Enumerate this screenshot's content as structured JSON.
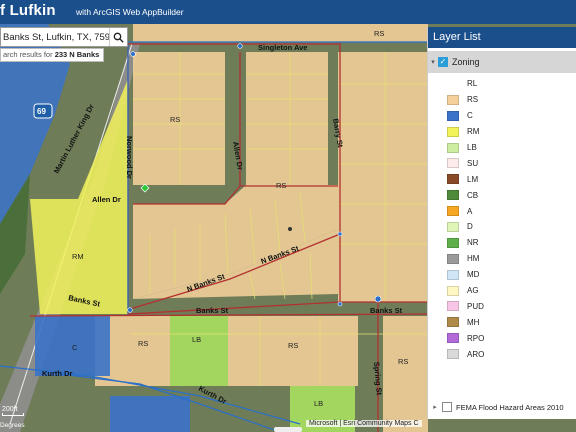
{
  "header": {
    "title": "f Lufkin",
    "subtitle": "with ArcGIS Web AppBuilder"
  },
  "search": {
    "value": "Banks St, Lufkin, TX, 759",
    "hint_prefix": "arch results for ",
    "hint_bold": "233 N Banks"
  },
  "layer_list": {
    "title": "Layer List",
    "group_label": "Zoning",
    "legend": [
      {
        "label": "RL",
        "color": ""
      },
      {
        "label": "RS",
        "color": "#f4d09a"
      },
      {
        "label": "C",
        "color": "#3a72c9"
      },
      {
        "label": "RM",
        "color": "#f2f25a"
      },
      {
        "label": "LB",
        "color": "#cdeea0"
      },
      {
        "label": "SU",
        "color": "#fdeaea"
      },
      {
        "label": "LM",
        "color": "#8a4a2a"
      },
      {
        "label": "CB",
        "color": "#4f8a3a"
      },
      {
        "label": "A",
        "color": "#f5a623"
      },
      {
        "label": "D",
        "color": "#dff5b8"
      },
      {
        "label": "NR",
        "color": "#5fb04a"
      },
      {
        "label": "HM",
        "color": "#9a9a9a"
      },
      {
        "label": "MD",
        "color": "#cfe6f7"
      },
      {
        "label": "AG",
        "color": "#fff7c2"
      },
      {
        "label": "PUD",
        "color": "#f7c6e6"
      },
      {
        "label": "MH",
        "color": "#b08a4a"
      },
      {
        "label": "RPO",
        "color": "#b36ad9"
      },
      {
        "label": "ARO",
        "color": "#d9d9d9"
      }
    ],
    "fema_label": "FEMA Flood Hazard Areas 2010"
  },
  "map": {
    "streets": {
      "singleton": "Singleton Ave",
      "mlk": "Martin Luther King Dr",
      "norwood": "Norwood Dr",
      "allen_a": "Allen Dr",
      "allen_b": "Allen Dr",
      "barry": "Barry St",
      "n_banks_a": "N Banks St",
      "n_banks_b": "N Banks St",
      "banks_west": "Banks St",
      "banks_mid": "Banks St",
      "banks_east": "Banks St",
      "kurth_a": "Kurth Dr",
      "kurth_b": "Kurth Dr",
      "spring": "Spring St"
    },
    "zones": {
      "rs_top": "RS",
      "rs_nw": "RS",
      "rs_center": "RS",
      "rm": "RM",
      "c": "C",
      "rs_south_w": "RS",
      "lb": "LB",
      "rs_south_c": "RS",
      "rs_south_e": "RS",
      "lb_bottom": "LB"
    },
    "highway_shield": "69"
  },
  "footer": {
    "scale": "200ft",
    "coords": "Degrees",
    "attribution": "Microsoft | Esri Community Maps C"
  },
  "colors": {
    "header": "#1b4f8c",
    "rs": "#f4d09a",
    "rm": "#f2f25a",
    "c": "#3a72c9",
    "lb": "#cdeea0"
  }
}
